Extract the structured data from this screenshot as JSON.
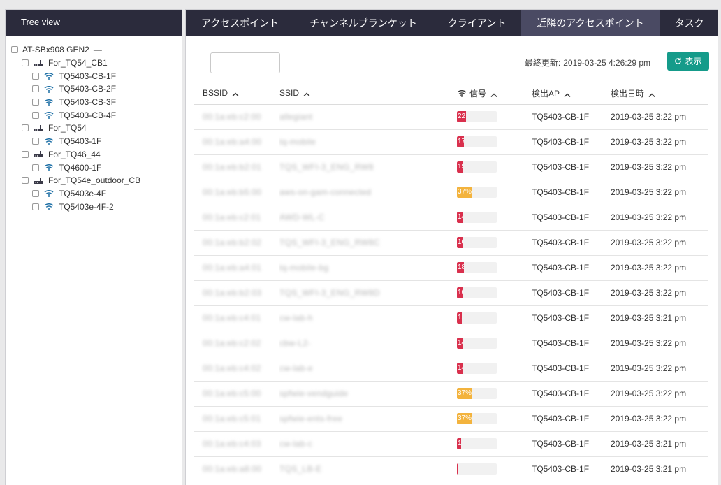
{
  "tree": {
    "header": "Tree view",
    "root": {
      "label": "AT-SBx908 GEN2",
      "collapse": "—"
    },
    "groups": [
      {
        "label": "For_TQ54_CB1",
        "children": [
          "TQ5403-CB-1F",
          "TQ5403-CB-2F",
          "TQ5403-CB-3F",
          "TQ5403-CB-4F"
        ]
      },
      {
        "label": "For_TQ54",
        "children": [
          "TQ5403-1F"
        ]
      },
      {
        "label": "For_TQ46_44",
        "children": [
          "TQ4600-1F"
        ]
      },
      {
        "label": "For_TQ54e_outdoor_CB",
        "children": [
          "TQ5403e-4F",
          "TQ5403e-4F-2"
        ]
      }
    ]
  },
  "tabs": [
    {
      "label": "アクセスポイント",
      "active": false
    },
    {
      "label": "チャンネルブランケット",
      "active": false
    },
    {
      "label": "クライアント",
      "active": false
    },
    {
      "label": "近隣のアクセスポイント",
      "active": true
    },
    {
      "label": "タスク",
      "active": false
    }
  ],
  "toolbar": {
    "filter_value": "",
    "last_updated_label": "最終更新:",
    "last_updated_value": "2019-03-25 4:26:29 pm",
    "show_button": "表示"
  },
  "table": {
    "headers": {
      "bssid": "BSSID",
      "ssid": "SSID",
      "signal": "信号",
      "detected_ap": "検出AP",
      "detected_at": "検出日時"
    },
    "colors": {
      "low": "#d9304d",
      "mid": "#f3b33d"
    },
    "rows": [
      {
        "bssid": "00:1a:eb:c2:00",
        "ssid": "allegiant",
        "signal": 22,
        "signal_label": "22",
        "level": "low",
        "ap": "TQ5403-CB-1F",
        "time": "2019-03-25 3:22 pm"
      },
      {
        "bssid": "00:1a:eb:a4:00",
        "ssid": "tq-mobile",
        "signal": 17,
        "signal_label": "17",
        "level": "low",
        "ap": "TQ5403-CB-1F",
        "time": "2019-03-25 3:22 pm"
      },
      {
        "bssid": "00:1a:eb:b2:01",
        "ssid": "TQS_WFI-3_ENG_RW8",
        "signal": 15,
        "signal_label": "15",
        "level": "low",
        "ap": "TQ5403-CB-1F",
        "time": "2019-03-25 3:22 pm"
      },
      {
        "bssid": "00:1a:eb:b5:00",
        "ssid": "aws-on-gam-connected",
        "signal": 37,
        "signal_label": "37%",
        "level": "mid",
        "ap": "TQ5403-CB-1F",
        "time": "2019-03-25 3:22 pm"
      },
      {
        "bssid": "00:1a:eb:c2:01",
        "ssid": "AWD-WL-C",
        "signal": 14,
        "signal_label": "14",
        "level": "low",
        "ap": "TQ5403-CB-1F",
        "time": "2019-03-25 3:22 pm"
      },
      {
        "bssid": "00:1a:eb:b2:02",
        "ssid": "TQS_WFI-3_ENG_RW8C",
        "signal": 16,
        "signal_label": "16",
        "level": "low",
        "ap": "TQ5403-CB-1F",
        "time": "2019-03-25 3:22 pm"
      },
      {
        "bssid": "00:1a:eb:a4:01",
        "ssid": "tq-mobile-bg",
        "signal": 18,
        "signal_label": "18",
        "level": "low",
        "ap": "TQ5403-CB-1F",
        "time": "2019-03-25 3:22 pm"
      },
      {
        "bssid": "00:1a:eb:b2:03",
        "ssid": "TQS_WFI-3_ENG_RW8D",
        "signal": 16,
        "signal_label": "16",
        "level": "low",
        "ap": "TQ5403-CB-1F",
        "time": "2019-03-25 3:22 pm"
      },
      {
        "bssid": "00:1a:eb:c4:01",
        "ssid": "cw-lab-h",
        "signal": 13,
        "signal_label": "13",
        "level": "low",
        "ap": "TQ5403-CB-1F",
        "time": "2019-03-25 3:21 pm"
      },
      {
        "bssid": "00:1a:eb:c2:02",
        "ssid": "cbw-L2-",
        "signal": 14,
        "signal_label": "14",
        "level": "low",
        "ap": "TQ5403-CB-1F",
        "time": "2019-03-25 3:22 pm"
      },
      {
        "bssid": "00:1a:eb:c4:02",
        "ssid": "cw-lab-e",
        "signal": 14,
        "signal_label": "14",
        "level": "low",
        "ap": "TQ5403-CB-1F",
        "time": "2019-03-25 3:22 pm"
      },
      {
        "bssid": "00:1a:eb:c5:00",
        "ssid": "spfwie-vendguide",
        "signal": 37,
        "signal_label": "37%",
        "level": "mid",
        "ap": "TQ5403-CB-1F",
        "time": "2019-03-25 3:22 pm"
      },
      {
        "bssid": "00:1a:eb:c5:01",
        "ssid": "spfwie-ents-free",
        "signal": 37,
        "signal_label": "37%",
        "level": "mid",
        "ap": "TQ5403-CB-1F",
        "time": "2019-03-25 3:22 pm"
      },
      {
        "bssid": "00:1a:eb:c4:03",
        "ssid": "cw-lab-c",
        "signal": 10,
        "signal_label": "1",
        "level": "low",
        "ap": "TQ5403-CB-1F",
        "time": "2019-03-25 3:21 pm"
      },
      {
        "bssid": "00:1a:eb:a8:00",
        "ssid": "TQS_LB-E",
        "signal": 0,
        "signal_label": "",
        "level": "low",
        "ap": "TQ5403-CB-1F",
        "time": "2019-03-25 3:21 pm"
      }
    ]
  }
}
